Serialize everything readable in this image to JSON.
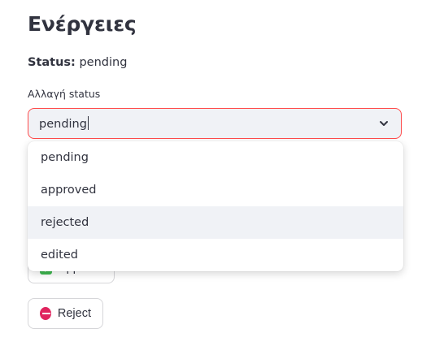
{
  "header": {
    "title": "Ενέργειες"
  },
  "status": {
    "label": "Status:",
    "value": "pending"
  },
  "status_select": {
    "label": "Αλλαγή status",
    "value": "pending",
    "options": [
      "pending",
      "approved",
      "rejected",
      "edited"
    ],
    "hovered_option": "rejected",
    "focus_border_color": "#ff4b4b"
  },
  "actions": {
    "approve_label": "Approve",
    "approve_icon": "check-mark-icon",
    "reject_label": "Reject",
    "reject_icon": "no-entry-icon"
  }
}
